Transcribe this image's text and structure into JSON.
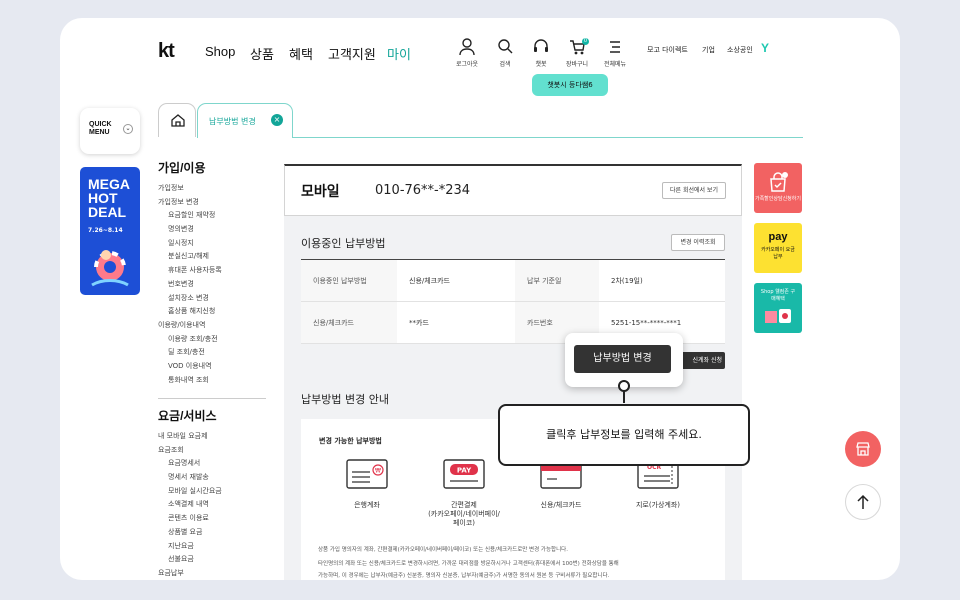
{
  "header": {
    "logo": "kt",
    "nav": [
      "Shop",
      "상품",
      "혜택",
      "고객지원",
      "마이"
    ],
    "icons": [
      {
        "label": "로그아웃",
        "icon": "person-icon"
      },
      {
        "label": "검색",
        "icon": "search-icon"
      },
      {
        "label": "챗봇",
        "icon": "headset-icon"
      },
      {
        "label": "장바구니",
        "icon": "cart-icon",
        "badge": "0"
      },
      {
        "label": "전체메뉴",
        "icon": "menu-icon"
      }
    ],
    "util": [
      "모고 다이렉트",
      "기업",
      "소상공인"
    ],
    "y_badge": "Y",
    "chat_tooltip": "챗봇시 등다쌤6"
  },
  "quick_menu": {
    "line1": "QUICK",
    "line2": "MENU"
  },
  "promo": {
    "line1": "MEGA",
    "line2": "HOT",
    "line3": "DEAL",
    "dates": "7.26~8.14"
  },
  "tabs": {
    "active_label": "납부방법 변경",
    "close": "×"
  },
  "sidebar": {
    "section1_title": "가입/이용",
    "section1_items": [
      {
        "label": "가입정보",
        "sub": false
      },
      {
        "label": "가입정보 변경",
        "sub": false
      },
      {
        "label": "요금할인 재약정",
        "sub": true
      },
      {
        "label": "명의변경",
        "sub": true
      },
      {
        "label": "일시정지",
        "sub": true
      },
      {
        "label": "분실신고/해제",
        "sub": true
      },
      {
        "label": "휴대폰 사용자등록",
        "sub": true
      },
      {
        "label": "번호변경",
        "sub": true
      },
      {
        "label": "설치장소 변경",
        "sub": true
      },
      {
        "label": "홈상품 해지신청",
        "sub": true
      },
      {
        "label": "이용량/이용내역",
        "sub": false
      },
      {
        "label": "이용량 조회/충전",
        "sub": true
      },
      {
        "label": "딜 조회/충전",
        "sub": true
      },
      {
        "label": "VOD 이용내역",
        "sub": true
      },
      {
        "label": "통화내역 조회",
        "sub": true
      }
    ],
    "section2_title": "요금/서비스",
    "section2_items": [
      {
        "label": "내 모바일 요금제",
        "sub": false
      },
      {
        "label": "요금조회",
        "sub": false
      },
      {
        "label": "요금명세서",
        "sub": true
      },
      {
        "label": "명세서 재발송",
        "sub": true
      },
      {
        "label": "모바일 실시간요금",
        "sub": true
      },
      {
        "label": "소액결제 내역",
        "sub": true
      },
      {
        "label": "콘텐츠 이용료",
        "sub": true
      },
      {
        "label": "상품별 요금",
        "sub": true
      },
      {
        "label": "지난요금",
        "sub": true
      },
      {
        "label": "선불요금",
        "sub": true
      },
      {
        "label": "요금납부",
        "sub": false
      }
    ]
  },
  "account": {
    "type": "모바일",
    "number": "010-76**-*234",
    "other_button": "다른 회선에서 보기"
  },
  "payment": {
    "title": "이용중인 납부방법",
    "history_button": "변경 이력조회",
    "rows": [
      [
        "이용중인 납부방법",
        "신용/체크카드",
        "납부 기준일",
        "2차(19일)"
      ],
      [
        "신용/체크카드",
        "**카드",
        "카드번호",
        "5251-15**-****-***1"
      ]
    ]
  },
  "change_button": "납부방법 변경",
  "peek_button": "신계좌 신청",
  "callout": "클릭후 납부정보를 입력해 주세요.",
  "guide": {
    "title": "납부방법 변경 안내",
    "subtitle": "변경 가능한 납부방법",
    "methods": [
      {
        "label": "은행계좌",
        "icon": "bank-icon"
      },
      {
        "label": "간편결제\n(카카오페이/네이버페이/\n페이코)",
        "icon": "pay-icon",
        "badge": "PAY"
      },
      {
        "label": "신용/체크카드",
        "icon": "card-icon"
      },
      {
        "label": "지로(가상계좌)",
        "icon": "giro-icon",
        "badge": "OCR"
      }
    ],
    "notes": [
      "상품 가입 명의자의 계좌, 간편결제(카카오페이/네이버페이/페이코) 또는 신용/체크카드로만 변경 가능합니다.",
      "타인명의의 계좌 또는 신용/체크카드로 변경하시려면, 가까운 대리점을 방문하시거나 고객센터(휴대폰에서 100번) 전화상담을 통해",
      "가능하며, 이 경우에는 납부자(예금주) 신분증, 명의자 신분증, 납부자(예금주)가 서명한 동의서 원본 등 구비서류가 필요합니다."
    ]
  },
  "banners": [
    {
      "label": "가족할인상담신청하기",
      "color": "#f26262"
    },
    {
      "label": "카카오페이 요금납부",
      "brand": "pay",
      "color": "#fde131"
    },
    {
      "label": "Shop 웰컴존 구매혜택",
      "color": "#19b9a8"
    }
  ],
  "floating": {
    "store_icon": "store-icon",
    "top_icon": "arrow-up-icon"
  }
}
